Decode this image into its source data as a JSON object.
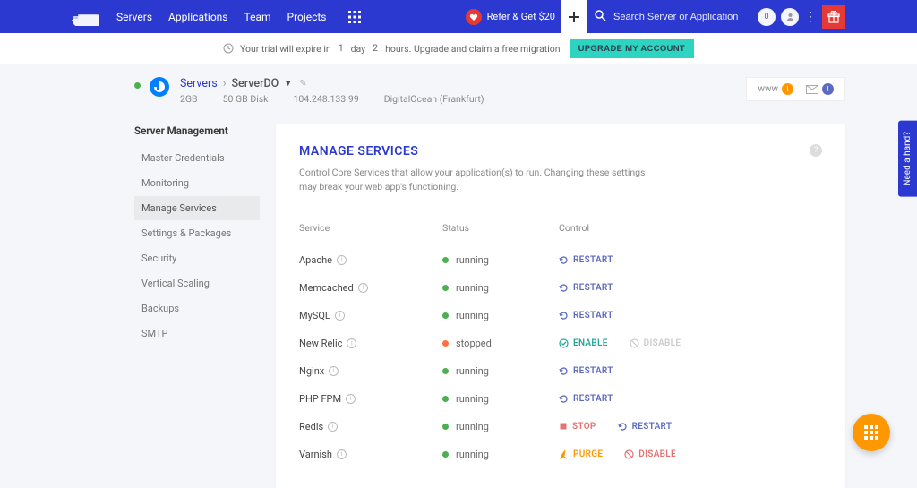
{
  "nav": {
    "servers": "Servers",
    "applications": "Applications",
    "team": "Team",
    "projects": "Projects"
  },
  "refer": {
    "label": "Refer & Get $20"
  },
  "search": {
    "placeholder": "Search Server or Application"
  },
  "notif_count": "0",
  "trial": {
    "prefix": "Your trial will expire in",
    "days": "1",
    "day_label": "day",
    "hours": "2",
    "hours_label": "hours. Upgrade and claim a free migration",
    "button": "UPGRADE MY ACCOUNT"
  },
  "breadcrumb": {
    "servers": "Servers",
    "name": "ServerDO",
    "specs": [
      "2GB",
      "50 GB Disk",
      "104.248.133.99",
      "DigitalOcean (Frankfurt)"
    ]
  },
  "pills": {
    "www": "www",
    "www_badge": "!",
    "mail_badge": "!"
  },
  "sidebar": {
    "title": "Server Management",
    "items": [
      {
        "label": "Master Credentials",
        "active": false
      },
      {
        "label": "Monitoring",
        "active": false
      },
      {
        "label": "Manage Services",
        "active": true
      },
      {
        "label": "Settings & Packages",
        "active": false
      },
      {
        "label": "Security",
        "active": false
      },
      {
        "label": "Vertical Scaling",
        "active": false
      },
      {
        "label": "Backups",
        "active": false
      },
      {
        "label": "SMTP",
        "active": false
      }
    ]
  },
  "panel": {
    "title": "MANAGE SERVICES",
    "subtitle": "Control Core Services that allow your application(s) to run. Changing these settings may break your web app's functioning.",
    "headers": {
      "service": "Service",
      "status": "Status",
      "control": "Control"
    }
  },
  "services": [
    {
      "name": "Apache",
      "status": "running",
      "controls": [
        {
          "label": "RESTART",
          "style": "purple",
          "icon": "refresh"
        }
      ]
    },
    {
      "name": "Memcached",
      "status": "running",
      "controls": [
        {
          "label": "RESTART",
          "style": "purple",
          "icon": "refresh"
        }
      ]
    },
    {
      "name": "MySQL",
      "status": "running",
      "controls": [
        {
          "label": "RESTART",
          "style": "purple",
          "icon": "refresh"
        }
      ]
    },
    {
      "name": "New Relic",
      "status": "stopped",
      "controls": [
        {
          "label": "ENABLE",
          "style": "teal",
          "icon": "check"
        },
        {
          "label": "DISABLE",
          "style": "gray",
          "icon": "ban"
        }
      ]
    },
    {
      "name": "Nginx",
      "status": "running",
      "controls": [
        {
          "label": "RESTART",
          "style": "purple",
          "icon": "refresh"
        }
      ]
    },
    {
      "name": "PHP FPM",
      "status": "running",
      "controls": [
        {
          "label": "RESTART",
          "style": "purple",
          "icon": "refresh"
        }
      ]
    },
    {
      "name": "Redis",
      "status": "running",
      "controls": [
        {
          "label": "STOP",
          "style": "red",
          "icon": "stop"
        },
        {
          "label": "RESTART",
          "style": "purple",
          "icon": "refresh"
        }
      ]
    },
    {
      "name": "Varnish",
      "status": "running",
      "controls": [
        {
          "label": "PURGE",
          "style": "orange",
          "icon": "broom"
        },
        {
          "label": "DISABLE",
          "style": "red",
          "icon": "ban"
        }
      ]
    }
  ],
  "side_tab": "Need a hand?"
}
